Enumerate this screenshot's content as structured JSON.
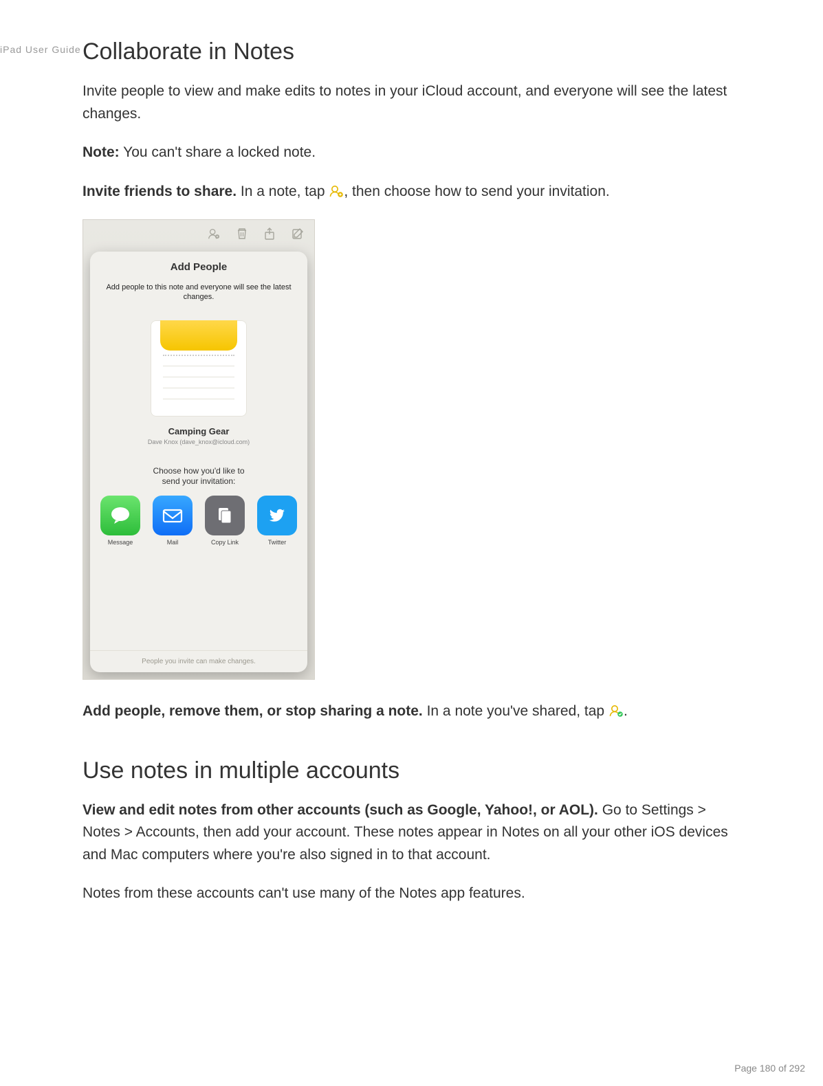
{
  "header_small": "iPad User Guide",
  "s1": {
    "heading": "Collaborate in Notes",
    "intro": "Invite people to view and make edits to notes in your iCloud account, and everyone will see the latest changes.",
    "note_label": "Note:",
    "note_text": " You can't share a locked note.",
    "invite_label": "Invite friends to share.",
    "invite_pre": " In a note, tap ",
    "invite_post": ", then choose how to send your invitation.",
    "manage_label": "Add people, remove them, or stop sharing a note.",
    "manage_pre": " In a note you've shared, tap ",
    "manage_post": "."
  },
  "popover": {
    "title": "Add People",
    "sub": "Add people to this note and everyone will see the latest changes.",
    "note_title": "Camping Gear",
    "note_owner": "Dave Knox (dave_knox@icloud.com)",
    "choose1": "Choose how you'd like to",
    "choose2": "send your invitation:",
    "apps": {
      "msg": "Message",
      "mail": "Mail",
      "copy": "Copy Link",
      "twitter": "Twitter"
    },
    "foot": "People you invite can make changes."
  },
  "s2": {
    "heading": "Use notes in multiple accounts",
    "view_label": "View and edit notes from other accounts (such as Google, Yahoo!, or AOL).",
    "view_text": " Go to Settings > Notes > Accounts, then add your account. These notes appear in Notes on all your other iOS devices and Mac computers where you're also signed in to that account.",
    "limit": "Notes from these accounts can't use many of the Notes app features."
  },
  "page": "Page 180 of 292"
}
